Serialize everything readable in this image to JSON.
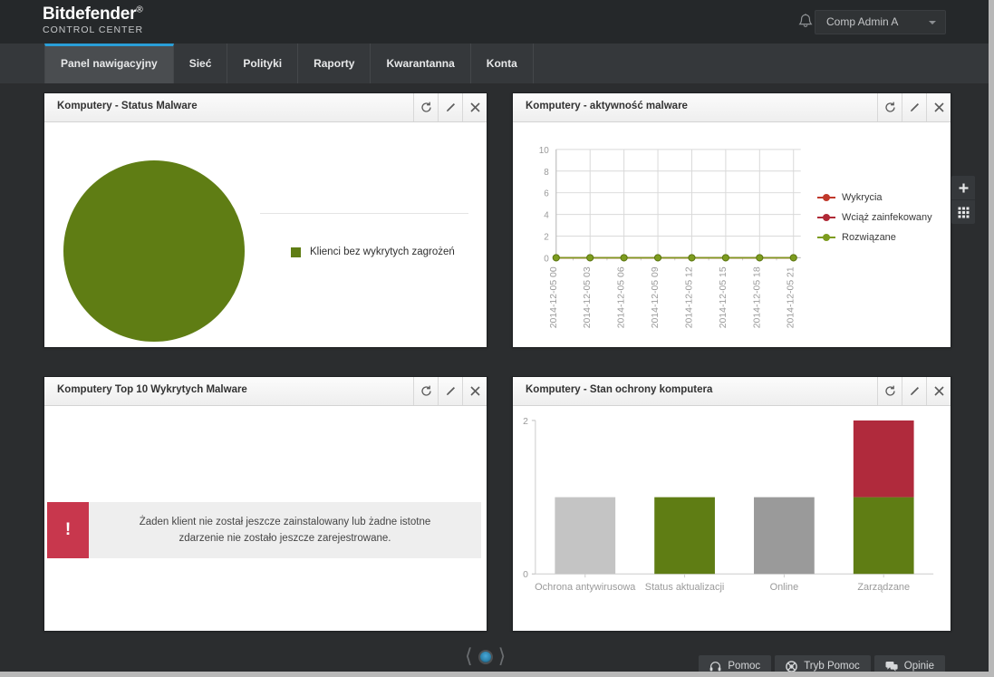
{
  "header": {
    "brand_name": "Bitdefender",
    "brand_reg": "®",
    "brand_sub": "CONTROL CENTER",
    "notifications_icon": "bell-icon",
    "user_name": "Comp Admin A"
  },
  "nav": {
    "tabs": [
      {
        "label": "Panel nawigacyjny",
        "active": true
      },
      {
        "label": "Sieć",
        "active": false
      },
      {
        "label": "Polityki",
        "active": false
      },
      {
        "label": "Raporty",
        "active": false
      },
      {
        "label": "Kwarantanna",
        "active": false
      },
      {
        "label": "Konta",
        "active": false
      }
    ]
  },
  "portlet_actions": {
    "refresh_label": "Odśwież",
    "edit_label": "Edytuj",
    "close_label": "Zamknij"
  },
  "sidetools": {
    "add_label": "+",
    "add_icon": "plus-icon",
    "grid_icon": "grid-icon"
  },
  "portlets": [
    {
      "title": "Komputery - Status Malware"
    },
    {
      "title": "Komputery - aktywność malware"
    },
    {
      "title": "Komputery Top 10 Wykrytych Malware"
    },
    {
      "title": "Komputery - Stan ochrony komputera"
    }
  ],
  "top10": {
    "alert_icon": "!",
    "alert_text": "Żaden klient nie został jeszcze zainstalowany lub żadne istotne zdarzenie nie zostało jeszcze zarejestrowane."
  },
  "footer": {
    "prev_icon": "chevron-left-icon",
    "next_icon": "chevron-right-icon",
    "page_indicator": "1",
    "buttons": [
      {
        "label": "Pomoc",
        "icon": "headset-icon"
      },
      {
        "label": "Tryb Pomoc",
        "icon": "lifebuoy-icon"
      },
      {
        "label": "Opinie",
        "icon": "chat-icon"
      }
    ]
  },
  "colors": {
    "green": "#5f7d14",
    "red": "#c0392b",
    "dark_red": "#b02a37",
    "crimson": "#b02a3c",
    "grey_light": "#c4c4c4",
    "grey_mid": "#9a9a9a",
    "accent_blue": "#2a9fd8"
  },
  "chart_data": [
    {
      "id": "malware-status-pie",
      "type": "pie",
      "title": "Komputery - Status Malware",
      "categories": [
        "Klienci bez wykrytych zagrożeń"
      ],
      "values": [
        100
      ],
      "colors": [
        "#5f7d14"
      ],
      "legend_position": "right",
      "labels_shown": false
    },
    {
      "id": "malware-activity-line",
      "type": "line",
      "title": "Komputery - aktywność malware",
      "x": [
        "2014-12-05 00",
        "2014-12-05 03",
        "2014-12-05 06",
        "2014-12-05 09",
        "2014-12-05 12",
        "2014-12-05 15",
        "2014-12-05 18",
        "2014-12-05 21"
      ],
      "yticks": [
        0,
        2,
        4,
        6,
        8,
        10
      ],
      "ylim": [
        0,
        10
      ],
      "xlabel": "",
      "ylabel": "",
      "grid": true,
      "legend_position": "right",
      "series": [
        {
          "name": "Wykrycia",
          "color": "#c0392b",
          "values": [
            0,
            0,
            0,
            0,
            0,
            0,
            0,
            0
          ]
        },
        {
          "name": "Wciąż zainfekowany",
          "color": "#b02a37",
          "values": [
            0,
            0,
            0,
            0,
            0,
            0,
            0,
            0
          ]
        },
        {
          "name": "Rozwiązane",
          "color": "#7d9c1f",
          "values": [
            0,
            0,
            0,
            0,
            0,
            0,
            0,
            0
          ]
        }
      ]
    },
    {
      "id": "top10-malware",
      "type": "table",
      "title": "Komputery Top 10 Wykrytych Malware",
      "empty": true,
      "empty_message": "Żaden klient nie został jeszcze zainstalowany lub żadne istotne zdarzenie nie zostało jeszcze zarejestrowane."
    },
    {
      "id": "protection-status-bar",
      "type": "bar",
      "title": "Komputery - Stan ochrony komputera",
      "categories": [
        "Ochrona antywirusowa",
        "Status aktualizacji",
        "Online",
        "Zarządzane"
      ],
      "yticks": [
        0,
        2
      ],
      "ylim": [
        0,
        2
      ],
      "xlabel": "",
      "ylabel": "",
      "grid": false,
      "stacked": true,
      "series": [
        {
          "name": "green",
          "color": "#5f7d14",
          "values": [
            0,
            1,
            0,
            1
          ]
        },
        {
          "name": "grey-light",
          "color": "#c4c4c4",
          "values": [
            1,
            0,
            0,
            0
          ]
        },
        {
          "name": "grey-mid",
          "color": "#9a9a9a",
          "values": [
            0,
            0,
            1,
            0
          ]
        },
        {
          "name": "crimson",
          "color": "#b02a3c",
          "values": [
            0,
            0,
            0,
            1
          ]
        }
      ],
      "totals": [
        1,
        1,
        1,
        2
      ]
    }
  ]
}
